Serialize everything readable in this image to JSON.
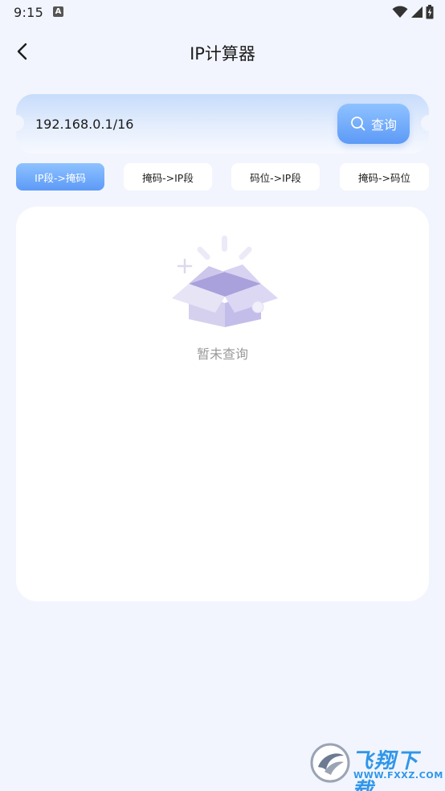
{
  "status_bar": {
    "time": "9:15",
    "notification_icon": "a-icon",
    "icons": [
      "wifi-icon",
      "signal-icon",
      "battery-charging-icon"
    ]
  },
  "header": {
    "title": "IP计算器",
    "back_icon": "chevron-left-icon"
  },
  "search": {
    "value": "192.168.0.1/16",
    "button_label": "查询",
    "button_icon": "search-icon"
  },
  "tabs": [
    {
      "label": "IP段->掩码",
      "active": true
    },
    {
      "label": "掩码->IP段",
      "active": false
    },
    {
      "label": "码位->IP段",
      "active": false
    },
    {
      "label": "掩码->码位",
      "active": false
    }
  ],
  "result": {
    "empty_icon": "empty-box-icon",
    "empty_text": "暂未查询"
  },
  "watermark": {
    "text": "飞翔下载",
    "url": "WWW.FXXZ.COM"
  },
  "colors": {
    "accent": "#5d9af7",
    "accent_light": "#8ec2ff",
    "background": "#f2f5fd",
    "muted_text": "#9a9a9a"
  }
}
